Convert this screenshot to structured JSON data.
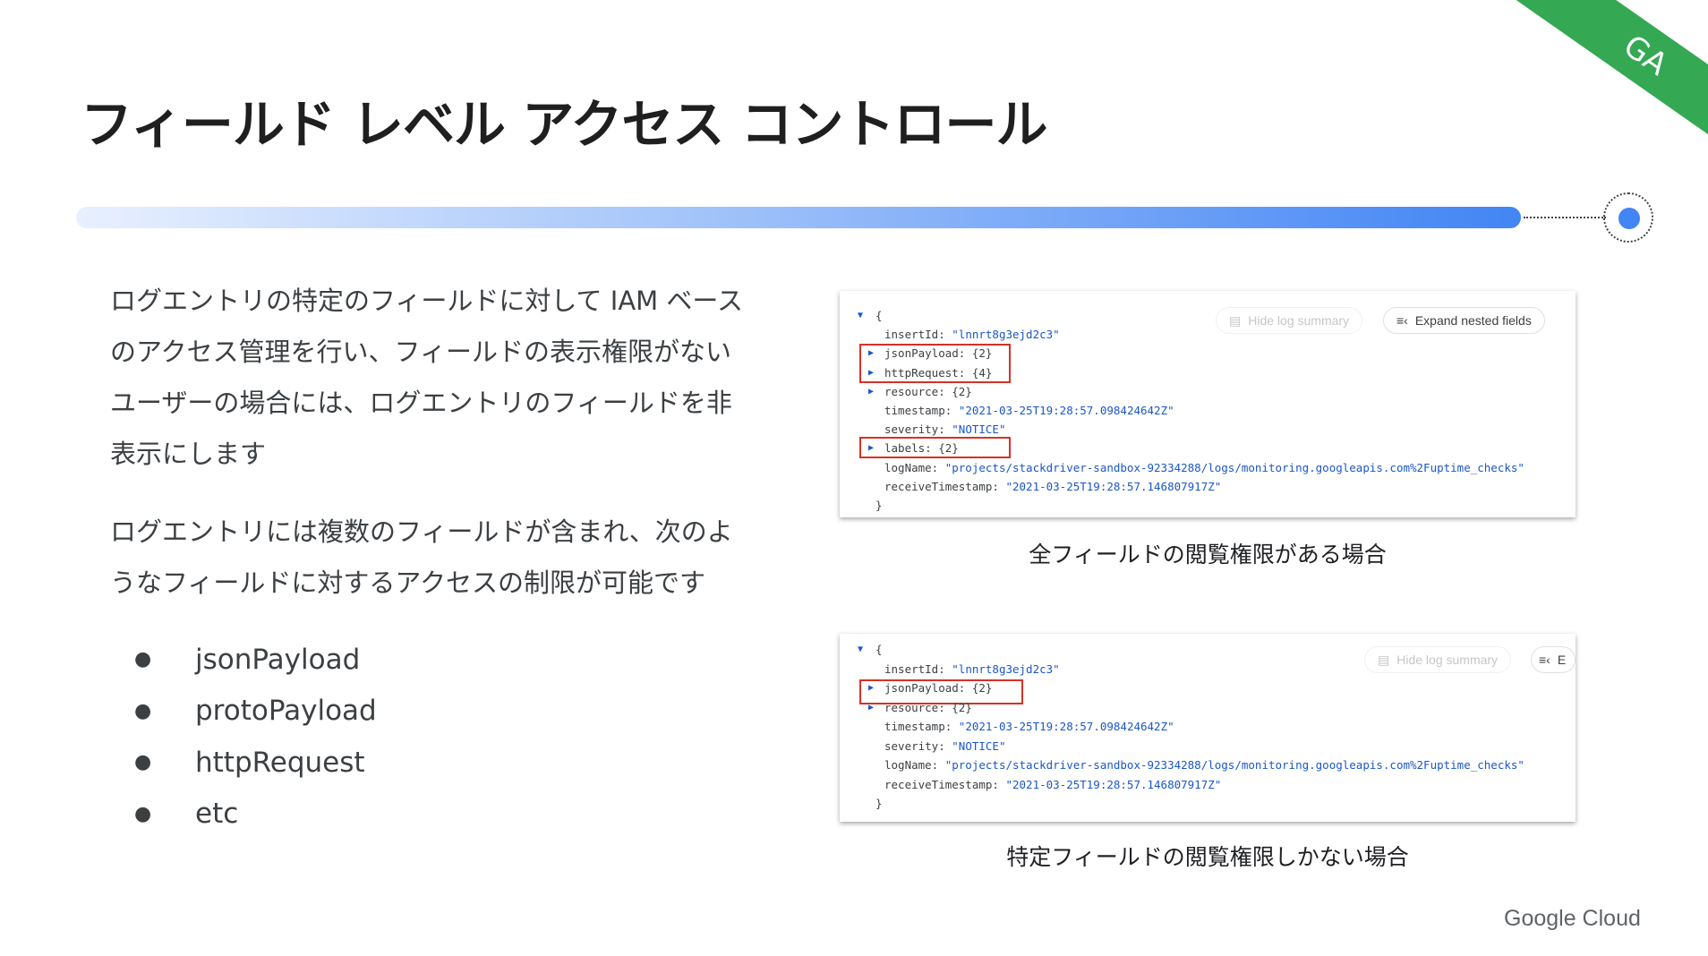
{
  "title": "フィールド レベル アクセス コントロール",
  "badge": "GA",
  "paragraph1": [
    "ログエントリの特定のフィールドに対して IAM ベース",
    "のアクセス管理を行い、フィールドの表示権限がない",
    "ユーザーの場合には、ログエントリのフィールドを非",
    "表示にします"
  ],
  "paragraph2": [
    "ログエントリには複数のフィールドが含まれ、次のよ",
    "うなフィールドに対するアクセスの制限が可能です"
  ],
  "bullets": [
    "jsonPayload",
    "protoPayload",
    "httpRequest",
    "etc"
  ],
  "panel1": {
    "hide_summary": "Hide log summary",
    "expand_nested": "Expand nested fields",
    "lines": [
      {
        "k": "{",
        "v": "",
        "arrow": "down"
      },
      {
        "k": "insertId: ",
        "v": "\"lnnrt8g3ejd2c3\""
      },
      {
        "k": "jsonPayload: {2}",
        "v": "",
        "arrow": "right"
      },
      {
        "k": "httpRequest: {4}",
        "v": "",
        "arrow": "right"
      },
      {
        "k": "resource: {2}",
        "v": "",
        "arrow": "right"
      },
      {
        "k": "timestamp: ",
        "v": "\"2021-03-25T19:28:57.098424642Z\""
      },
      {
        "k": "severity: ",
        "v": "\"NOTICE\""
      },
      {
        "k": "labels: {2}",
        "v": "",
        "arrow": "right"
      },
      {
        "k": "logName: ",
        "v": "\"projects/stackdriver-sandbox-92334288/logs/monitoring.googleapis.com%2Fuptime_checks\""
      },
      {
        "k": "receiveTimestamp: ",
        "v": "\"2021-03-25T19:28:57.146807917Z\""
      },
      {
        "k": "}",
        "v": ""
      }
    ],
    "caption": "全フィールドの閲覧権限がある場合"
  },
  "panel2": {
    "hide_summary": "Hide log summary",
    "expand_nested": "E",
    "lines": [
      {
        "k": "{",
        "v": "",
        "arrow": "down"
      },
      {
        "k": "insertId: ",
        "v": "\"lnnrt8g3ejd2c3\""
      },
      {
        "k": "jsonPayload: {2}",
        "v": "",
        "arrow": "right"
      },
      {
        "k": "resource: {2}",
        "v": "",
        "arrow": "right"
      },
      {
        "k": "timestamp: ",
        "v": "\"2021-03-25T19:28:57.098424642Z\""
      },
      {
        "k": "severity: ",
        "v": "\"NOTICE\""
      },
      {
        "k": "logName: ",
        "v": "\"projects/stackdriver-sandbox-92334288/logs/monitoring.googleapis.com%2Fuptime_checks\""
      },
      {
        "k": "receiveTimestamp: ",
        "v": "\"2021-03-25T19:28:57.146807917Z\""
      },
      {
        "k": "}",
        "v": ""
      }
    ],
    "caption": "特定フィールドの閲覧権限しかない場合"
  },
  "footer": "Google Cloud",
  "colors": {
    "accent": "#4285f4",
    "badge": "#34a853",
    "highlight": "#d93025"
  }
}
